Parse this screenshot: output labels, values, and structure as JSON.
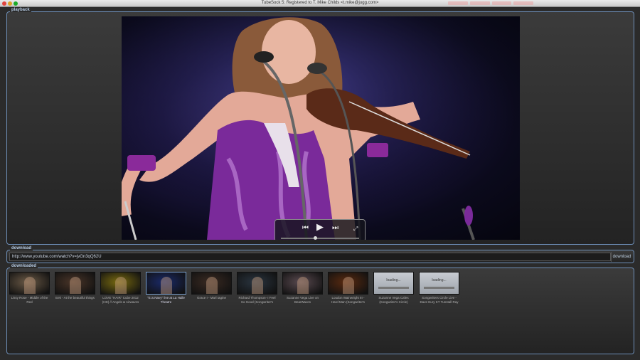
{
  "window": {
    "title": "TubeSock 5: Registered to T. Mike Childs <t.mike@jugg.com>"
  },
  "playback": {
    "legend": "playback"
  },
  "controls": {
    "prev_icon": "⏮",
    "play_icon": "▶",
    "next_icon": "⏭",
    "fullscreen_icon": "⤢",
    "progress": 0.44
  },
  "download": {
    "legend": "download",
    "url": "http://www.youtube.com/watch?v=jvGn3qQ62U",
    "button_label": "download"
  },
  "downloaded": {
    "legend": "downloaded",
    "items": [
      {
        "label": "Lissy Rose - Middle of the Red",
        "thumb_color": "#6b5a46"
      },
      {
        "label": "Eek - At the beautiful things",
        "thumb_color": "#4a3528"
      },
      {
        "label": "LOVE \"HAIR\" Cube 2012 (HD) // Angels & Airwaves (Mov)",
        "thumb_color": "#7a6b10"
      },
      {
        "label": "\"E.S.Navy\" live at La Halle Theatre",
        "thumb_color": "#1a2a6a"
      },
      {
        "label": "Grace I - Marl tagine",
        "thumb_color": "#3a2a22"
      },
      {
        "label": "Richard Thompson- I Feel So Good (Songwriter's Circle)",
        "thumb_color": "#2a3540"
      },
      {
        "label": "Suzanne Vega Live on BearWaves",
        "thumb_color": "#5a4a50"
      },
      {
        "label": "Loudon Wainwright III - Hard Man (Songwriter's Circle)",
        "thumb_color": "#5a2a10"
      },
      {
        "label": "Suzanne Vega Cafes (Songwriter's Circle)",
        "loading": "loading..."
      },
      {
        "label": "Songwriters Circle Live - Dave Eury KT Tunstall Ray LaMont...",
        "loading": "loading..."
      }
    ]
  }
}
